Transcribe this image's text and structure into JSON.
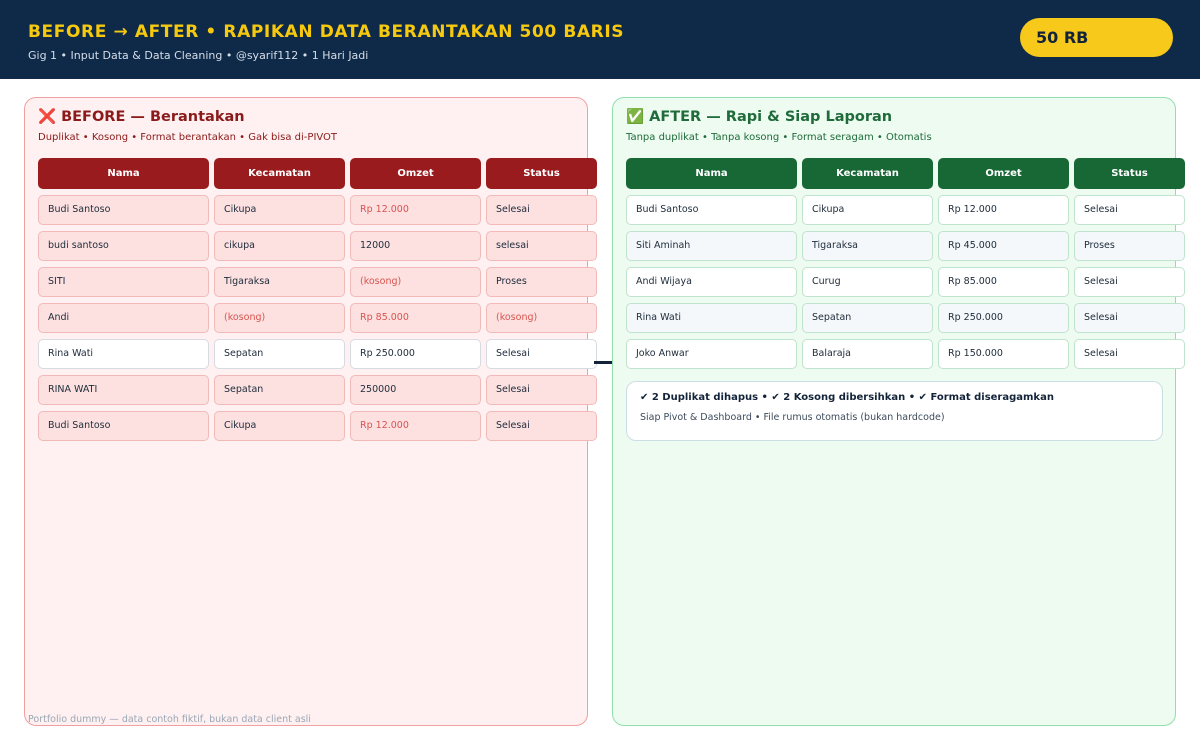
{
  "header": {
    "title": "BEFORE  →  AFTER  •  RAPIKAN DATA BERANTAKAN 500 BARIS",
    "subtitle": "Gig 1 • Input Data & Data Cleaning  •  @syarif112  •  1 Hari Jadi",
    "price": "50 RB"
  },
  "before": {
    "title": "❌ BEFORE — Berantakan",
    "subtitle": "Duplikat • Kosong • Format berantakan • Gak bisa di-PIVOT",
    "columns": [
      "Nama",
      "Kecamatan",
      "Omzet",
      "Status"
    ],
    "rows": [
      [
        "Budi Santoso",
        "Cikupa",
        "Rp 12.000",
        "Selesai"
      ],
      [
        "budi santoso",
        "cikupa",
        "12000",
        "selesai"
      ],
      [
        "SITI",
        "Tigaraksa",
        "(kosong)",
        "Proses"
      ],
      [
        "Andi",
        "(kosong)",
        "Rp 85.000",
        "(kosong)"
      ],
      [
        "Rina Wati",
        "Sepatan",
        "Rp 250.000",
        "Selesai"
      ],
      [
        "RINA WATI",
        "Sepatan",
        "250000",
        "Selesai"
      ],
      [
        "Budi Santoso",
        "Cikupa",
        "Rp 12.000",
        "Selesai"
      ]
    ]
  },
  "after": {
    "title": "✅ AFTER — Rapi & Siap Laporan",
    "subtitle": "Tanpa duplikat • Tanpa kosong • Format seragam • Otomatis",
    "columns": [
      "Nama",
      "Kecamatan",
      "Omzet",
      "Status"
    ],
    "rows": [
      [
        "Budi Santoso",
        "Cikupa",
        "Rp 12.000",
        "Selesai"
      ],
      [
        "Siti Aminah",
        "Tigaraksa",
        "Rp 45.000",
        "Proses"
      ],
      [
        "Andi Wijaya",
        "Curug",
        "Rp 85.000",
        "Selesai"
      ],
      [
        "Rina Wati",
        "Sepatan",
        "Rp 250.000",
        "Selesai"
      ],
      [
        "Joko Anwar",
        "Balaraja",
        "Rp 150.000",
        "Selesai"
      ]
    ],
    "summary": {
      "main": "✔ 2 Duplikat dihapus  •  ✔ 2 Kosong dibersihkan  •  ✔ Format diseragamkan",
      "sub": "Siap Pivot & Dashboard • File rumus otomatis (bukan hardcode)"
    }
  },
  "footer_note": "Portfolio dummy — data contoh fiktif, bukan data client asli",
  "colors": {
    "header_bg": "#0f2a48",
    "accent_yellow": "#f6c90f",
    "before_red": "#9a1b1e",
    "after_green": "#186836",
    "error_text": "#d9534f"
  }
}
